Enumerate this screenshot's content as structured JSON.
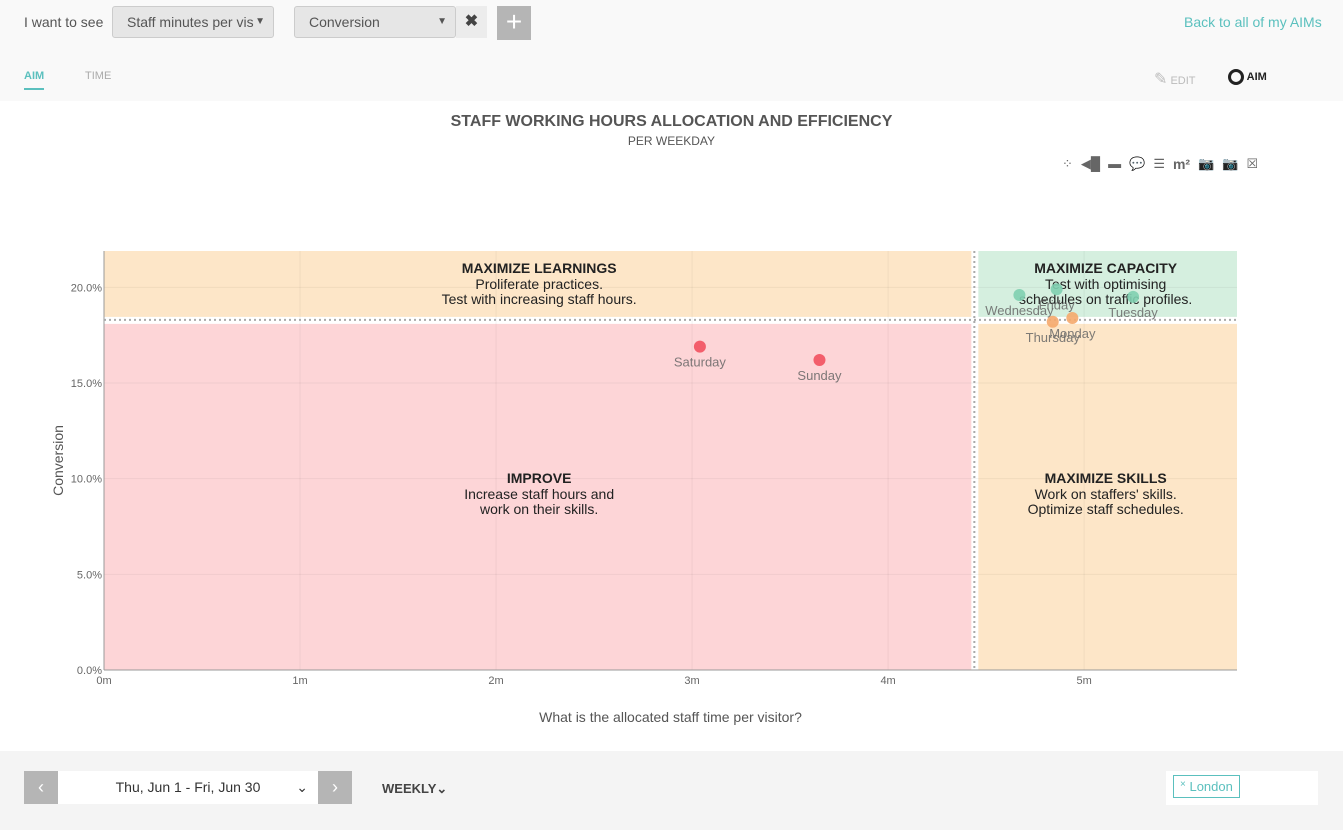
{
  "header": {
    "label": "I want to see",
    "metric_x": "Staff minutes per vis",
    "metric_y": "Conversion",
    "remove_icon": "close-icon",
    "add_icon": "plus-icon",
    "back_link": "Back to all of my AIMs"
  },
  "tabs": [
    {
      "label": "AIM",
      "active": true
    },
    {
      "label": "TIME",
      "active": false
    }
  ],
  "view": {
    "edit_label": "EDIT",
    "aim_label": "AIM"
  },
  "toolbar_icons": [
    "pointer-icon",
    "tag-icon",
    "tags-icon",
    "comment-icon",
    "legend-icon",
    "m2",
    "camera-icon",
    "camera-icon",
    "excel-icon"
  ],
  "toolbar_m2": "m²",
  "footer": {
    "date_range": "Thu, Jun 1 - Fri, Jun 30",
    "period": "WEEKLY",
    "location": "London",
    "prev": "‹",
    "next": "›",
    "remove": "×"
  },
  "chart_data": {
    "type": "scatter",
    "title": "STAFF WORKING HOURS ALLOCATION AND EFFICIENCY",
    "subtitle": "PER WEEKDAY",
    "xlabel": "What is the allocated staff time per visitor?",
    "ylabel": "Conversion",
    "xlim": [
      0,
      5.78
    ],
    "ylim": [
      0,
      21.9
    ],
    "xticks": [
      {
        "v": 0,
        "l": "0m"
      },
      {
        "v": 1,
        "l": "1m"
      },
      {
        "v": 2,
        "l": "2m"
      },
      {
        "v": 3,
        "l": "3m"
      },
      {
        "v": 4,
        "l": "4m"
      },
      {
        "v": 5,
        "l": "5m"
      }
    ],
    "yticks": [
      {
        "v": 0,
        "l": "0.0%"
      },
      {
        "v": 5,
        "l": "5.0%"
      },
      {
        "v": 10,
        "l": "10.0%"
      },
      {
        "v": 15,
        "l": "15.0%"
      },
      {
        "v": 20,
        "l": "20.0%"
      }
    ],
    "threshold_x": 4.44,
    "threshold_y": 18.3,
    "quadrants": [
      {
        "pos": "top-left",
        "title": "MAXIMIZE LEARNINGS",
        "text": [
          "Proliferate practices.",
          "Test with increasing staff hours."
        ],
        "color": "#fde6c8"
      },
      {
        "pos": "top-right",
        "title": "MAXIMIZE CAPACITY",
        "text": [
          "Test with optimising",
          "schedules on traffic profiles."
        ],
        "color": "#d5efdf"
      },
      {
        "pos": "bottom-left",
        "title": "IMPROVE",
        "text": [
          "Increase staff hours and",
          "work on their skills."
        ],
        "color": "#fdd5d7"
      },
      {
        "pos": "bottom-right",
        "title": "MAXIMIZE SKILLS",
        "text": [
          "Work on staffers' skills.",
          "Optimize staff schedules."
        ],
        "color": "#fde6c8"
      }
    ],
    "points": [
      {
        "label": "Saturday",
        "x": 3.04,
        "y": 16.9,
        "color": "#f2515f"
      },
      {
        "label": "Sunday",
        "x": 3.65,
        "y": 16.2,
        "color": "#f2515f"
      },
      {
        "label": "Wednesday",
        "x": 4.67,
        "y": 19.6,
        "color": "#7fcfb0"
      },
      {
        "label": "Friday",
        "x": 4.86,
        "y": 19.9,
        "color": "#7fcfb0"
      },
      {
        "label": "Tuesday",
        "x": 5.25,
        "y": 19.5,
        "color": "#7fcfb0"
      },
      {
        "label": "Thursday",
        "x": 4.84,
        "y": 18.2,
        "color": "#f5a96b"
      },
      {
        "label": "Monday",
        "x": 4.94,
        "y": 18.4,
        "color": "#f5a96b"
      }
    ]
  }
}
